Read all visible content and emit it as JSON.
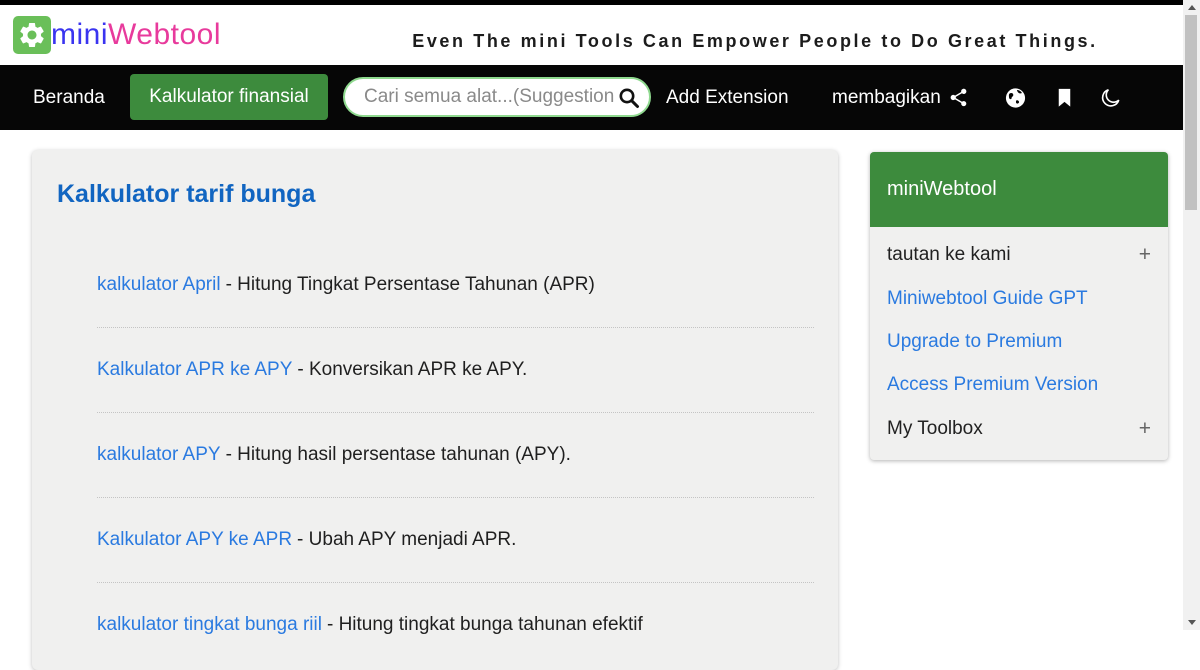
{
  "brand": {
    "prefix": "mini",
    "suffix": "Webtool",
    "tagline": "Even The mini Tools Can Empower People to Do Great Things."
  },
  "navbar": {
    "home_label": "Beranda",
    "active_label": "Kalkulator finansial",
    "search_placeholder": "Cari semua alat...(Suggestion",
    "add_extension_label": "Add Extension",
    "share_label": "membagikan"
  },
  "main": {
    "title": "Kalkulator tarif bunga",
    "tools": [
      {
        "link": "kalkulator April",
        "description": "- Hitung Tingkat Persentase Tahunan (APR)"
      },
      {
        "link": "Kalkulator APR ke APY",
        "description": "- Konversikan APR ke APY."
      },
      {
        "link": "kalkulator APY",
        "description": "- Hitung hasil persentase tahunan (APY)."
      },
      {
        "link": "Kalkulator APY ke APR",
        "description": "- Ubah APY menjadi APR."
      },
      {
        "link": "kalkulator tingkat bunga riil",
        "description": "- Hitung tingkat bunga tahunan efektif"
      }
    ]
  },
  "sidebar": {
    "header": "miniWebtool",
    "items": [
      {
        "label": "tautan ke kami",
        "suffix": "+"
      },
      {
        "label": "Miniwebtool Guide GPT"
      },
      {
        "label": "Upgrade to Premium"
      },
      {
        "label": "Access Premium Version"
      },
      {
        "label": "My Toolbox",
        "suffix": "+"
      }
    ]
  },
  "colors": {
    "brand_green": "#3d8b3d",
    "logo_badge_green": "#6abf59",
    "brand_blue": "#3a34f0",
    "brand_pink": "#e83a9c",
    "title_blue": "#1165c1",
    "link_blue": "#2a7ae0",
    "navbar_black": "#060606",
    "card_gray": "#f0f0ef",
    "search_border_green": "#8fd98f"
  }
}
